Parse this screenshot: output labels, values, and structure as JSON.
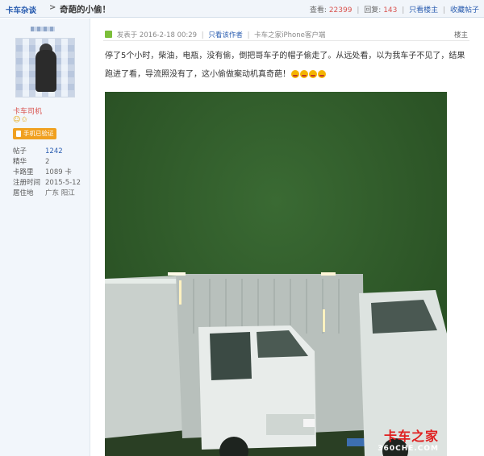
{
  "thread": {
    "breadcrumb": "卡车杂谈",
    "separator": ">",
    "title": "奇葩的小偷！"
  },
  "stats": {
    "views_label": "查看:",
    "views": "22399",
    "replies_label": "回复:",
    "replies": "143",
    "only_op": "只看楼主",
    "favorite": "收藏帖子"
  },
  "user": {
    "rank": "卡车司机",
    "verified": "手机已验证",
    "fields": [
      {
        "k": "帖子",
        "v": "1242",
        "link": true
      },
      {
        "k": "精华",
        "v": "2",
        "link": false
      },
      {
        "k": "卡路里",
        "v": "1089 卡",
        "link": false
      },
      {
        "k": "注册时间",
        "v": "2015-5-12",
        "link": false
      },
      {
        "k": "居住地",
        "v": "广东 阳江",
        "link": false
      }
    ]
  },
  "post": {
    "posted": "发表于 2016-2-18 00:29",
    "only_author": "只看该作者",
    "client": "卡车之家iPhone客户端",
    "floor": "楼主",
    "text": "停了5个小时，柴油，电瓶，没有偷，倒把哥车子的帽子偷走了。从远处看，以为我车子不见了，结果跑进了看，导流照没有了，这小偷做案动机真奇葩！"
  },
  "watermark": {
    "cn": "卡车之家",
    "en": "360CHE.COM"
  },
  "colors": {
    "link": "#2a5db0",
    "accent_red": "#d9534f",
    "badge_orange": "#f0a020",
    "photo_green": "#2e5a2a"
  },
  "icons": [
    "post-image-icon",
    "phone-icon",
    "smile-icon",
    "star-icon",
    "laugh-emoji-icon"
  ]
}
